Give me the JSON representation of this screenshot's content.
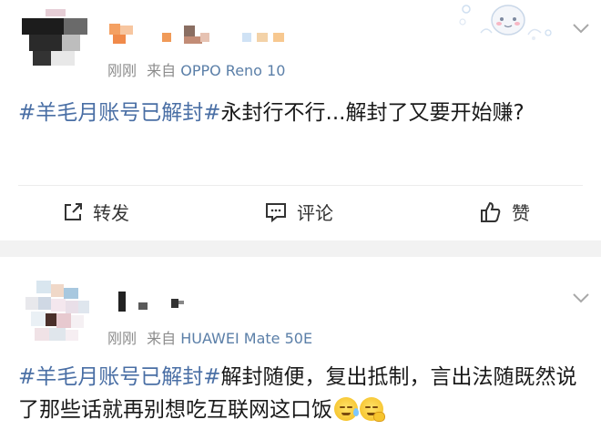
{
  "posts": [
    {
      "meta_time": "刚刚",
      "meta_from": "来自",
      "meta_device": "OPPO Reno 10",
      "topic": "#羊毛月账号已解封#",
      "text": "永封行不行...解封了又要开始赚?",
      "actions": {
        "repost": "转发",
        "comment": "评论",
        "like": "赞"
      }
    },
    {
      "meta_time": "刚刚",
      "meta_from": "来自",
      "meta_device": "HUAWEI Mate 50E",
      "topic": "#羊毛月账号已解封#",
      "text": "解封随便，复出抵制，言出法随既然说了那些话就再别想吃互联网这口饭",
      "emojis": [
        "sweat-smile-emoji",
        "salute-emoji"
      ]
    }
  ],
  "colors": {
    "topic": "#4a6fa5",
    "meta": "#8c8c8c",
    "device": "#5b7fa8",
    "separator": "#f2f2f2"
  }
}
